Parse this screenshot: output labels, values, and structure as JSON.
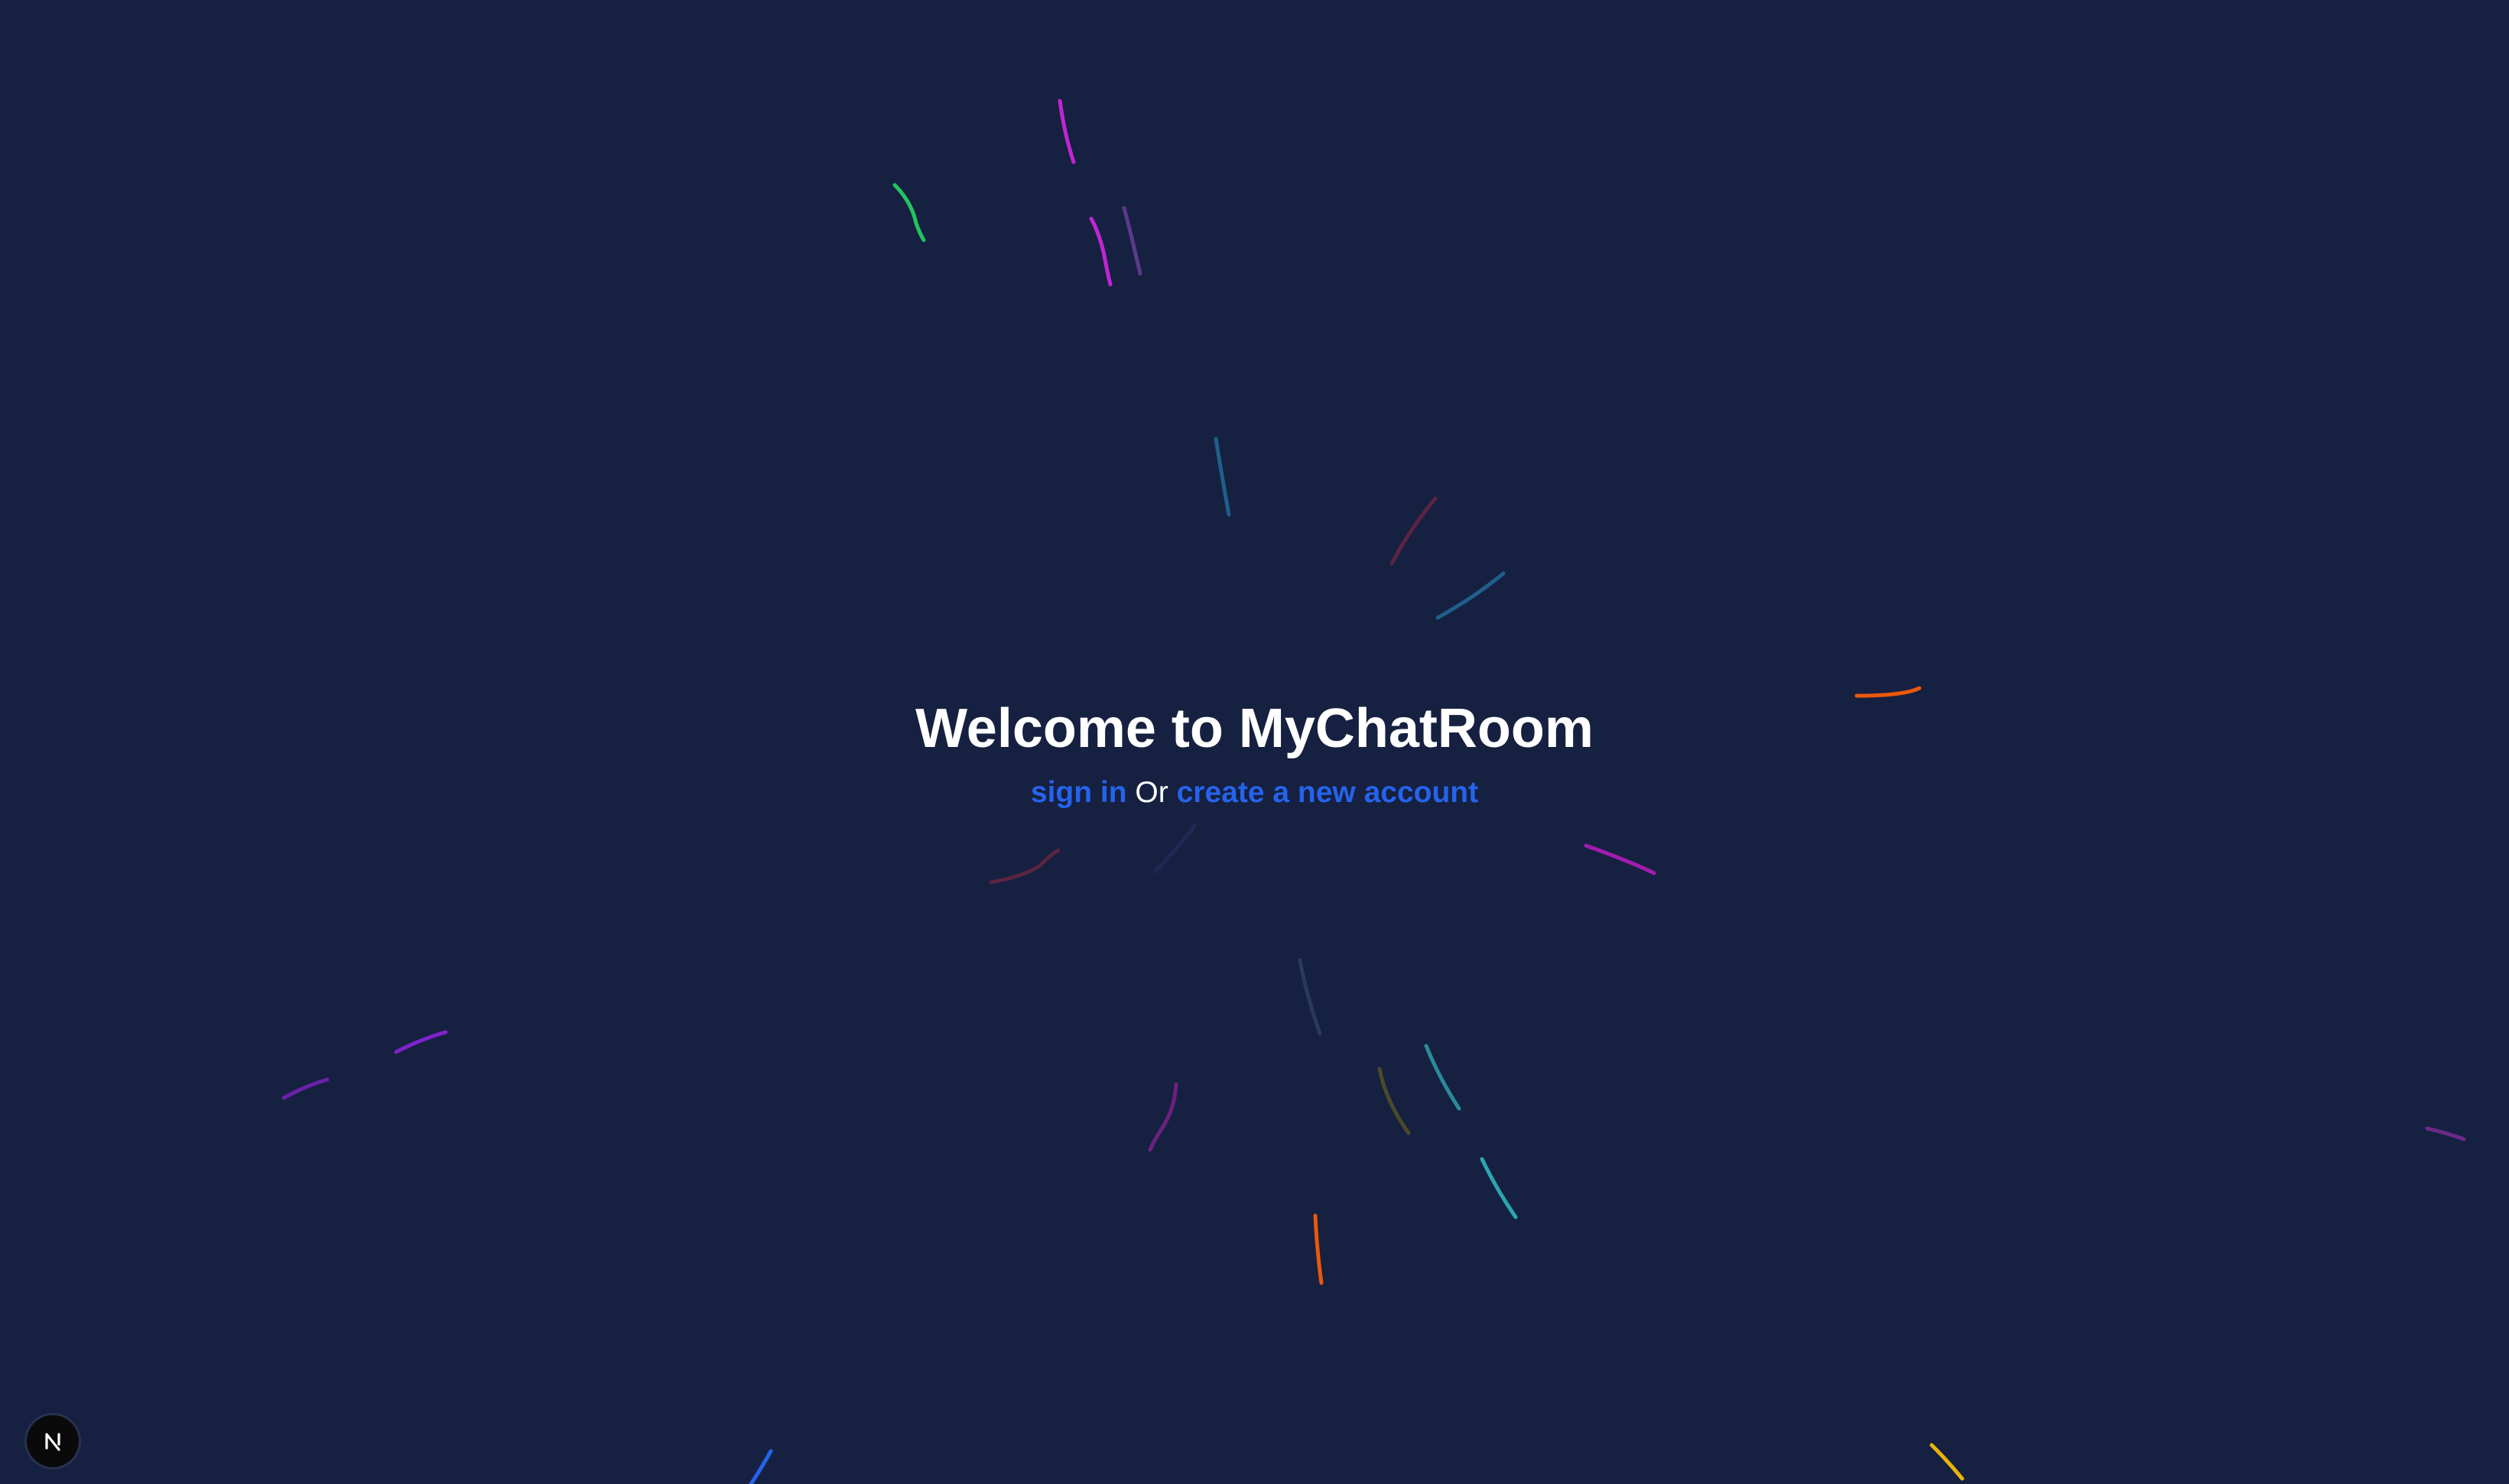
{
  "hero": {
    "title": "Welcome to MyChatRoom",
    "sign_in_label": "sign in",
    "or_label": "Or",
    "create_account_label": "create a new account"
  },
  "dev_indicator": {
    "label": "N",
    "icon": "nextjs-logo-icon"
  },
  "colors": {
    "background": "#162040",
    "title": "#ffffff",
    "link": "#2563eb"
  }
}
